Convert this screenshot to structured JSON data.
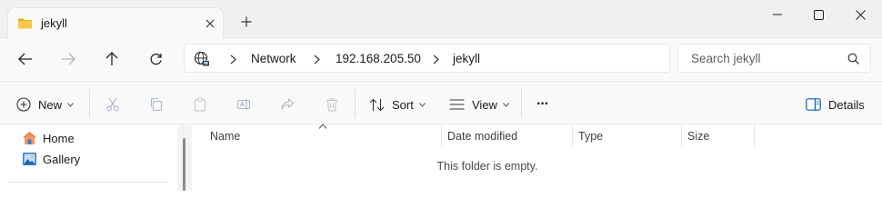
{
  "window": {
    "tab_title": "jekyll",
    "new_tab_symbol": "+",
    "close_tab_symbol": "✕"
  },
  "nav": {
    "breadcrumbs": [
      "Network",
      "192.168.205.50",
      "jekyll"
    ],
    "search_placeholder": "Search jekyll"
  },
  "commands": {
    "new_label": "New",
    "sort_label": "Sort",
    "view_label": "View",
    "more_label": "···",
    "details_label": "Details"
  },
  "sidebar": {
    "items": [
      {
        "label": "Home",
        "icon": "home-icon"
      },
      {
        "label": "Gallery",
        "icon": "gallery-icon"
      }
    ]
  },
  "content": {
    "columns": [
      "Name",
      "Date modified",
      "Type",
      "Size"
    ],
    "empty_message": "This folder is empty."
  },
  "colors": {
    "folder": "#f4c144",
    "accent": "#005fb8",
    "home": "#e8733a"
  }
}
